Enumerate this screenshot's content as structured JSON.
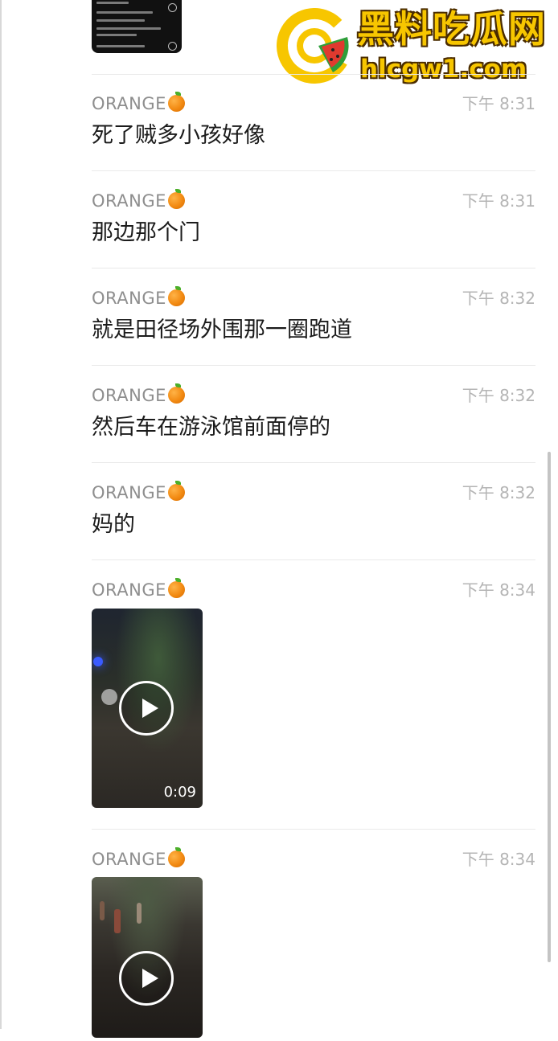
{
  "watermark": {
    "title": "黑料吃瓜网",
    "url": "hlcgw1.com",
    "colors": {
      "primary": "#f7c600",
      "outline": "#4a2c00",
      "melon_green": "#2e9e3a",
      "melon_red": "#e03a2f"
    }
  },
  "messages": [
    {
      "sender": "ORANGE",
      "emoji": "orange-emoji",
      "time": "下午 8:31",
      "text": "死了贼多小孩好像"
    },
    {
      "sender": "ORANGE",
      "emoji": "orange-emoji",
      "time": "下午 8:31",
      "text": "那边那个门"
    },
    {
      "sender": "ORANGE",
      "emoji": "orange-emoji",
      "time": "下午 8:32",
      "text": "就是田径场外围那一圈跑道"
    },
    {
      "sender": "ORANGE",
      "emoji": "orange-emoji",
      "time": "下午 8:32",
      "text": "然后车在游泳馆前面停的"
    },
    {
      "sender": "ORANGE",
      "emoji": "orange-emoji",
      "time": "下午 8:32",
      "text": "妈的"
    },
    {
      "sender": "ORANGE",
      "emoji": "orange-emoji",
      "time": "下午 8:34",
      "video": {
        "duration": "0:09"
      }
    },
    {
      "sender": "ORANGE",
      "emoji": "orange-emoji",
      "time": "下午 8:34",
      "video": {
        "duration": ""
      }
    }
  ],
  "colors": {
    "sender": "#8e8e8e",
    "time": "#b4b4b4",
    "text": "#1b1b1b",
    "divider": "#e9e9e9"
  }
}
